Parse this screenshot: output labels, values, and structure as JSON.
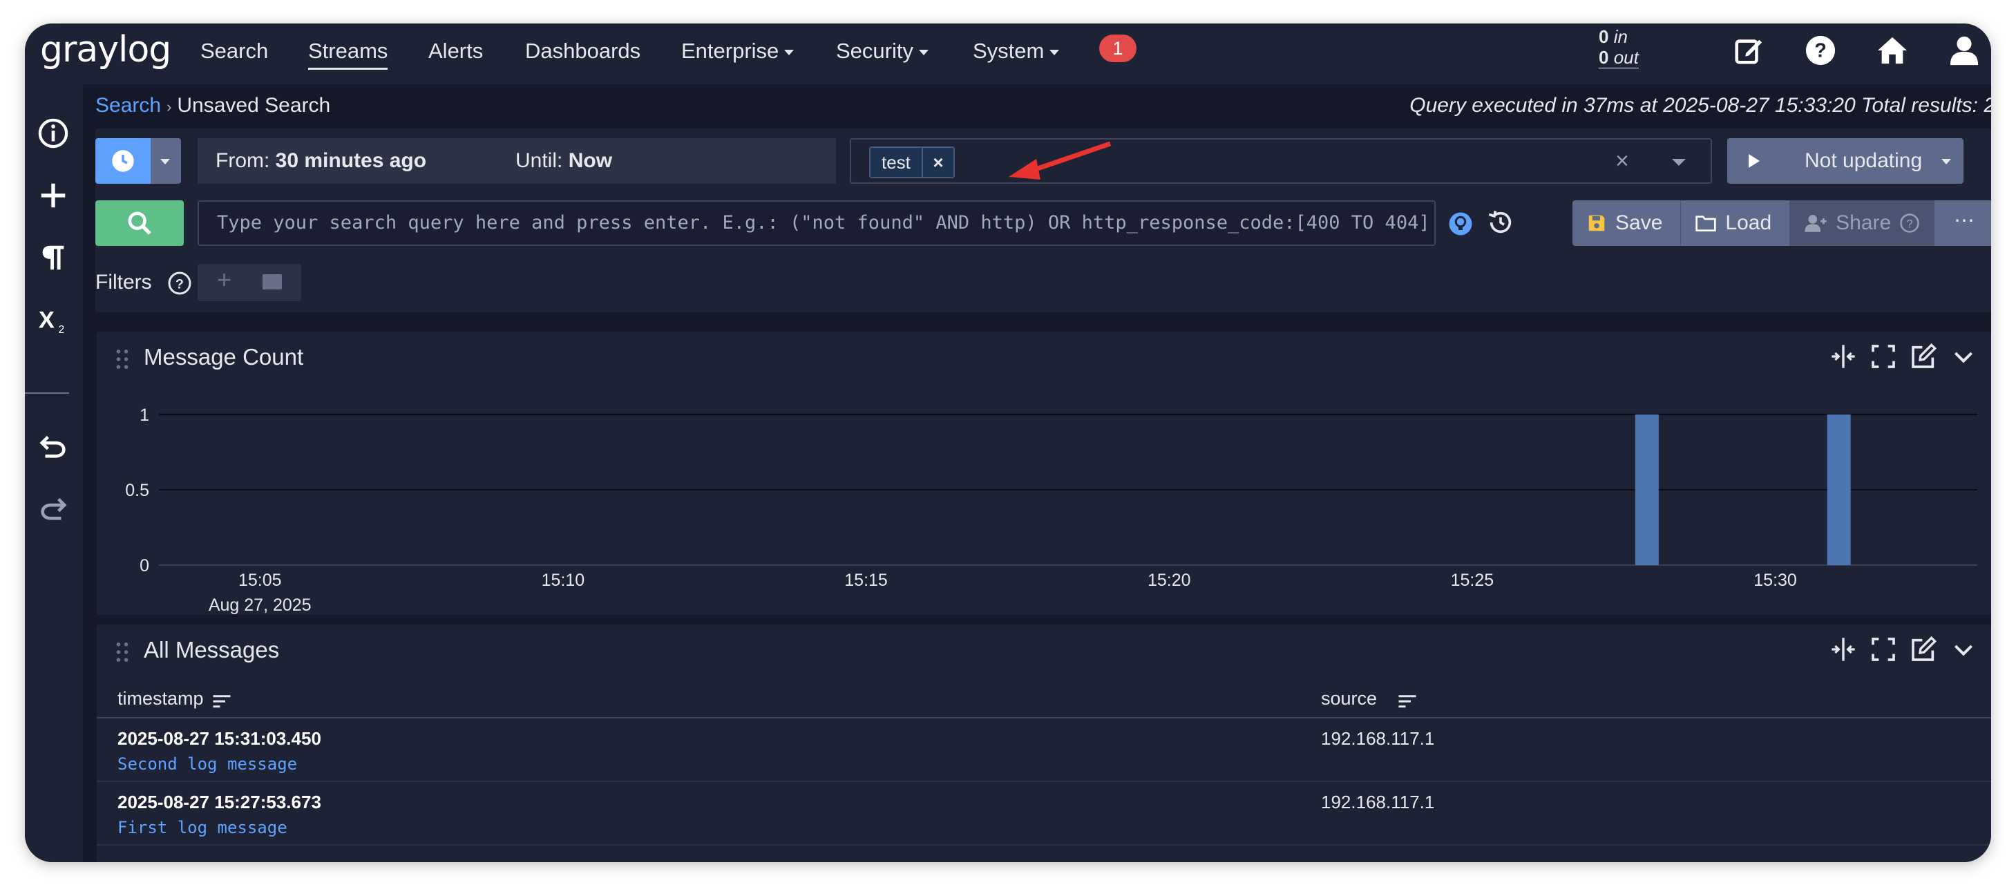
{
  "app": {
    "logo": "graylog",
    "nav": [
      {
        "label": "Search",
        "active": false,
        "dropdown": false
      },
      {
        "label": "Streams",
        "active": true,
        "dropdown": false
      },
      {
        "label": "Alerts",
        "active": false,
        "dropdown": false
      },
      {
        "label": "Dashboards",
        "active": false,
        "dropdown": false
      },
      {
        "label": "Enterprise",
        "active": false,
        "dropdown": true
      },
      {
        "label": "Security",
        "active": false,
        "dropdown": true
      },
      {
        "label": "System",
        "active": false,
        "dropdown": true
      }
    ],
    "notification_count": "1",
    "throughput": {
      "in_value": "0",
      "in_label": "in",
      "out_value": "0",
      "out_label": "out"
    },
    "top_icons": [
      "edit-icon",
      "help-icon",
      "home-icon",
      "user-icon"
    ]
  },
  "sidebar": {
    "icons": [
      "info-icon",
      "plus-icon",
      "paragraph-icon",
      "parameters-icon",
      "undo-icon",
      "redo-icon"
    ]
  },
  "breadcrumb": {
    "root": "Search",
    "current": "Unsaved Search"
  },
  "query_info": "Query executed in 37ms at 2025-08-27 15:33:20 Total results: 2",
  "search": {
    "time_from_label": "From:",
    "time_from_value": "30 minutes ago",
    "time_until_label": "Until:",
    "time_until_value": "Now",
    "stream_chip": "test",
    "stream_chip_remove": "×",
    "stream_clear": "×",
    "refresh_label": "Not updating",
    "query_placeholder": "Type your search query here and press enter. E.g.: (\"not found\" AND http) OR http_response_code:[400 TO 404]",
    "save_label": "Save",
    "load_label": "Load",
    "share_label": "Share",
    "more_label": "⋯",
    "filters_label": "Filters",
    "filter_add": "+"
  },
  "message_count": {
    "title": "Message Count"
  },
  "chart_data": {
    "type": "bar",
    "title": "Message Count",
    "x_ticks": [
      "15:05",
      "15:10",
      "15:15",
      "15:20",
      "15:25",
      "15:30"
    ],
    "x_sublabel": "Aug 27, 2025",
    "y_ticks": [
      "0",
      "0.5",
      "1"
    ],
    "ylim": [
      0,
      1
    ],
    "xlim": [
      "15:03:20",
      "15:33:20"
    ],
    "bars": [
      {
        "time": "15:27:53",
        "value": 1
      },
      {
        "time": "15:31:03",
        "value": 1
      }
    ],
    "bar_color": "#4d76b3",
    "grid": true
  },
  "all_messages": {
    "title": "All Messages",
    "columns": [
      "timestamp",
      "source"
    ],
    "rows": [
      {
        "timestamp": "2025-08-27 15:31:03.450",
        "message": "Second log message",
        "source": "192.168.117.1"
      },
      {
        "timestamp": "2025-08-27 15:27:53.673",
        "message": "First log message",
        "source": "192.168.117.1"
      }
    ]
  },
  "colors": {
    "accent": "#5ea1ff",
    "search_button": "#5fbf88",
    "badge": "#e34a4a",
    "annotation": "#e8332e"
  }
}
